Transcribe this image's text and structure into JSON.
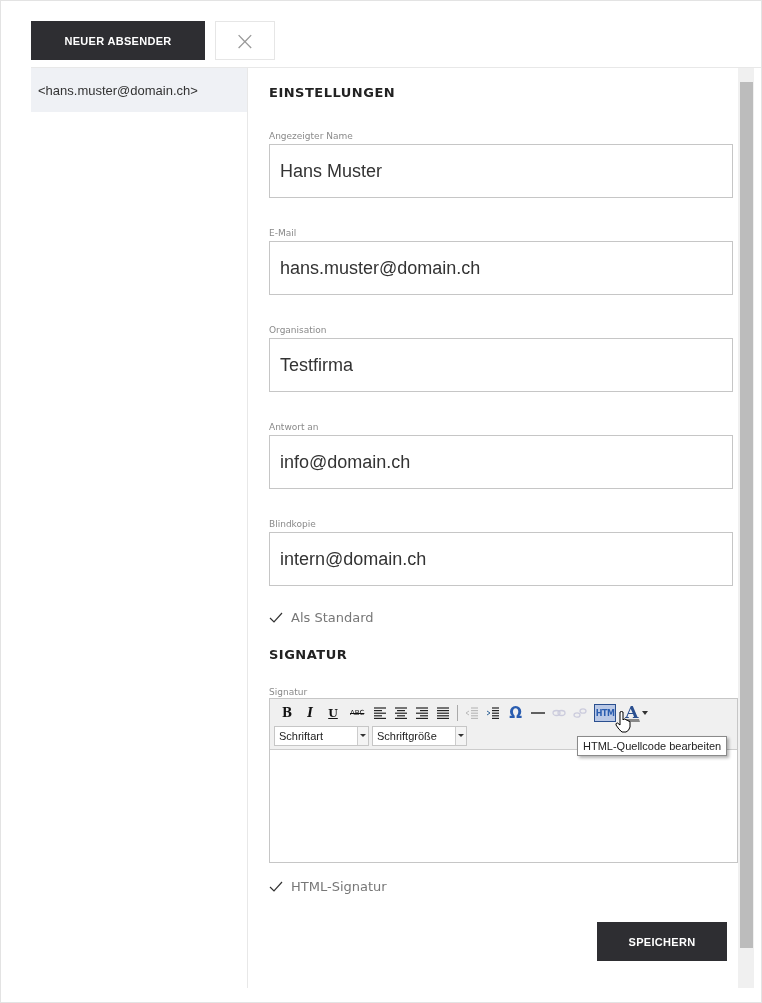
{
  "top_bar": {
    "new_sender_button": "NEUER ABSENDER",
    "close_button": "×"
  },
  "sidebar": {
    "items": [
      {
        "label": "<hans.muster@domain.ch>",
        "selected": true
      }
    ]
  },
  "settings": {
    "heading": "EINSTELLUNGEN",
    "fields": [
      {
        "label": "Angezeigter Name",
        "value": "Hans Muster"
      },
      {
        "label": "E-Mail",
        "value": "hans.muster@domain.ch"
      },
      {
        "label": "Organisation",
        "value": "Testfirma"
      },
      {
        "label": "Antwort an",
        "value": "info@domain.ch"
      },
      {
        "label": "Blindkopie",
        "value": "intern@domain.ch"
      }
    ],
    "default_checkbox": {
      "label": "Als Standard",
      "checked": true
    }
  },
  "signature": {
    "heading": "SIGNATUR",
    "label": "Signatur",
    "toolbar": [
      {
        "kind": "bold",
        "label": "B",
        "disabled": false
      },
      {
        "kind": "italic",
        "label": "I",
        "disabled": false
      },
      {
        "kind": "underline",
        "label": "U",
        "disabled": false
      },
      {
        "kind": "strike",
        "label": "ABC",
        "disabled": false
      },
      {
        "kind": "align-left",
        "disabled": false
      },
      {
        "kind": "align-center",
        "disabled": false
      },
      {
        "kind": "align-right",
        "disabled": false
      },
      {
        "kind": "align-justify",
        "disabled": false
      },
      {
        "kind": "separator"
      },
      {
        "kind": "outdent",
        "disabled": true
      },
      {
        "kind": "indent",
        "disabled": false
      },
      {
        "kind": "symbol",
        "label": "Ω",
        "disabled": false
      },
      {
        "kind": "rule",
        "disabled": false
      },
      {
        "kind": "link",
        "disabled": true
      },
      {
        "kind": "unlink",
        "disabled": true
      },
      {
        "kind": "html",
        "label": "HTM",
        "disabled": false,
        "hovered": true
      },
      {
        "kind": "color",
        "label": "A",
        "disabled": false
      }
    ],
    "font_select": "Schriftart",
    "size_select": "Schriftgröße",
    "tooltip": "HTML-Quellcode bearbeiten",
    "html_checkbox": {
      "label": "HTML-Signatur",
      "checked": true
    }
  },
  "save_button": "SPEICHERN"
}
